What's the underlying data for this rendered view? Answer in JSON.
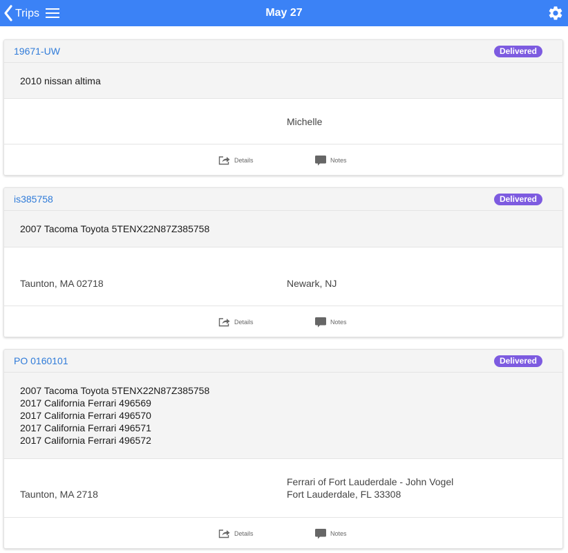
{
  "header": {
    "back_label": "Trips",
    "title": "May 27",
    "back_icon": "chevron-left-icon",
    "menu_icon": "hamburger-menu-icon",
    "settings_icon": "gear-icon",
    "bar_color": "#3b82f6"
  },
  "status_color": "#7d5be0",
  "trips": [
    {
      "order_id": "19671-UW",
      "status": "Delivered",
      "vehicles": [
        "2010 nissan altima"
      ],
      "origin": [],
      "destination": [
        "Michelle"
      ],
      "actions": {
        "details": "Details",
        "notes": "Notes"
      }
    },
    {
      "order_id": "is385758",
      "status": "Delivered",
      "vehicles": [
        "2007 Tacoma Toyota 5TENX22N87Z385758"
      ],
      "origin": [
        "Taunton, MA 02718"
      ],
      "destination": [
        "Newark, NJ"
      ],
      "actions": {
        "details": "Details",
        "notes": "Notes"
      }
    },
    {
      "order_id": "PO 0160101",
      "status": "Delivered",
      "vehicles": [
        "2007 Tacoma Toyota 5TENX22N87Z385758",
        "2017 California Ferrari 496569",
        "2017 California Ferrari 496570",
        "2017 California Ferrari 496571",
        "2017 California Ferrari 496572"
      ],
      "origin": [
        "Taunton, MA 2718"
      ],
      "destination": [
        "Ferrari of Fort Lauderdale - John Vogel",
        "Fort Lauderdale, FL 33308"
      ],
      "actions": {
        "details": "Details",
        "notes": "Notes"
      }
    }
  ]
}
